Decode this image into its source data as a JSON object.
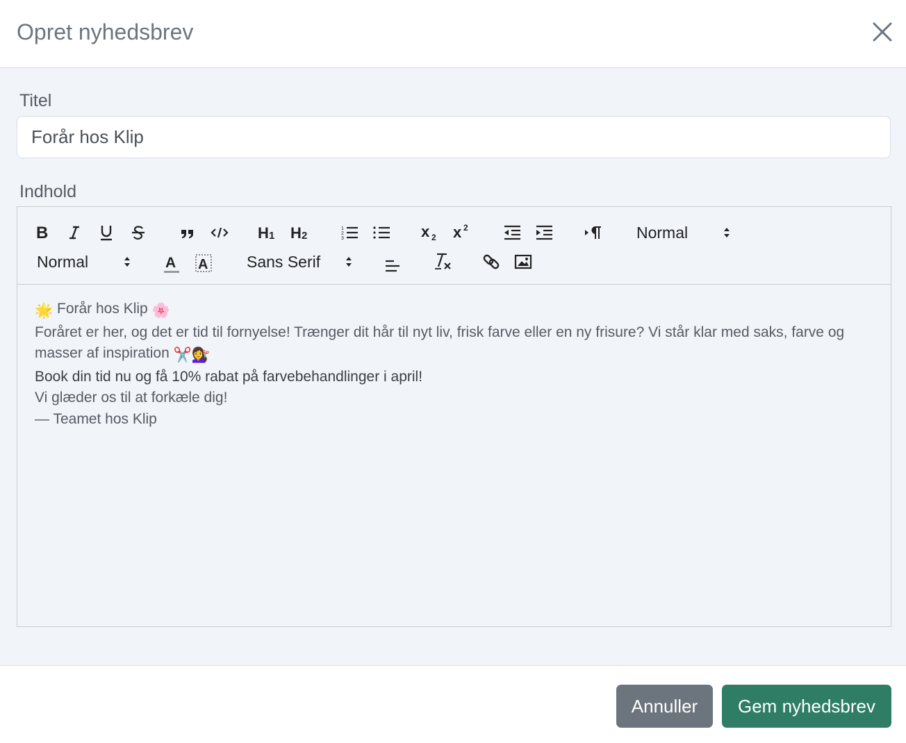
{
  "modal": {
    "title": "Opret nyhedsbrev",
    "close_icon": "close-icon"
  },
  "form": {
    "title_label": "Titel",
    "title_value": "Forår hos Klip",
    "content_label": "Indhold"
  },
  "toolbar": {
    "row1": {
      "bold": "B",
      "italic": "I",
      "underline": "U",
      "strike": "S",
      "header1": "H1",
      "header2": "H2",
      "subscript": "X2",
      "superscript": "X2",
      "header_picker": "Normal"
    },
    "row2": {
      "size_picker": "Normal",
      "font_picker": "Sans Serif"
    },
    "icons": [
      "bold-icon",
      "italic-icon",
      "underline-icon",
      "strike-icon",
      "blockquote-icon",
      "code-block-icon",
      "header1-icon",
      "header2-icon",
      "ordered-list-icon",
      "bullet-list-icon",
      "subscript-icon",
      "superscript-icon",
      "outdent-icon",
      "indent-icon",
      "direction-rtl-icon",
      "text-color-icon",
      "background-color-icon",
      "align-icon",
      "clean-format-icon",
      "link-icon",
      "image-icon"
    ]
  },
  "content": {
    "line1_prefix_emoji": "🌟",
    "line1_text": "Forår hos Klip",
    "line1_suffix_emoji": "🌸",
    "line2": "Foråret er her, og det er tid til fornyelse! Trænger dit hår til nyt liv, frisk farve eller en ny frisure? Vi står klar med saks, farve og",
    "line3_text": "masser af inspiration",
    "line3_emoji": "✂️💇‍♀️",
    "line4": "Book din tid nu og få 10% rabat på farvebehandlinger i april!",
    "line5": "Vi glæder os til at forkæle dig!",
    "line6": " — Teamet hos Klip"
  },
  "footer": {
    "cancel_label": "Annuller",
    "save_label": "Gem nyhedsbrev"
  },
  "colors": {
    "body_bg": "#f1f4f9",
    "save_button": "#2e7d64",
    "cancel_button": "#6c757d",
    "title_text": "#6c757d"
  }
}
